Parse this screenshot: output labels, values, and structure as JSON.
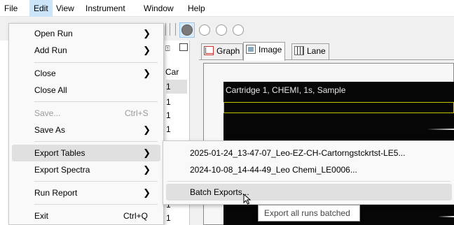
{
  "menubar": {
    "items": [
      "File",
      "Edit",
      "View",
      "Instrument",
      "Window",
      "Help"
    ],
    "active_index": 1
  },
  "file_menu": {
    "items": [
      {
        "label": "Open Run",
        "shortcut": "",
        "submenu": true,
        "enabled": true
      },
      {
        "label": "Add Run",
        "shortcut": "",
        "submenu": true,
        "enabled": true
      },
      {
        "label": "Close",
        "shortcut": "",
        "submenu": true,
        "enabled": true
      },
      {
        "label": "Close All",
        "shortcut": "",
        "submenu": false,
        "enabled": true
      },
      {
        "label": "Save...",
        "shortcut": "Ctrl+S",
        "submenu": false,
        "enabled": false
      },
      {
        "label": "Save As",
        "shortcut": "",
        "submenu": true,
        "enabled": true
      },
      {
        "label": "Export Tables",
        "shortcut": "",
        "submenu": true,
        "enabled": true,
        "highlighted": true
      },
      {
        "label": "Export Spectra",
        "shortcut": "",
        "submenu": true,
        "enabled": true
      },
      {
        "label": "Run Report",
        "shortcut": "",
        "submenu": true,
        "enabled": true
      },
      {
        "label": "Exit",
        "shortcut": "Ctrl+Q",
        "submenu": false,
        "enabled": true
      }
    ]
  },
  "export_tables_submenu": {
    "items": [
      {
        "label": "2025-01-24_13-47-07_Leo-EZ-CH-Cartorngstckrtst-LE5...",
        "highlighted": false
      },
      {
        "label": "2024-10-08_14-44-49_Leo Chemi_LE0006...",
        "highlighted": false
      },
      {
        "label": "Batch Exports...",
        "highlighted": true
      }
    ]
  },
  "tooltip": "Export all runs batched",
  "left_panel": {
    "column_header": "Car",
    "rows": [
      "1",
      "1",
      "1",
      "1",
      "1",
      "1",
      "1",
      "1",
      "1",
      "1"
    ]
  },
  "tabs": [
    {
      "label": "Graph",
      "icon": "graph-icon",
      "active": false
    },
    {
      "label": "Image",
      "icon": "image-icon",
      "active": true
    },
    {
      "label": "Lane",
      "icon": "lane-icon",
      "active": false
    }
  ],
  "image_view": {
    "title": "Cartridge 1, CHEMI, 1s, Sample"
  },
  "colors": {
    "highlight": "#cce4f7",
    "selection_box": "#c8c200",
    "menu_highlight": "#e0e0e0"
  }
}
